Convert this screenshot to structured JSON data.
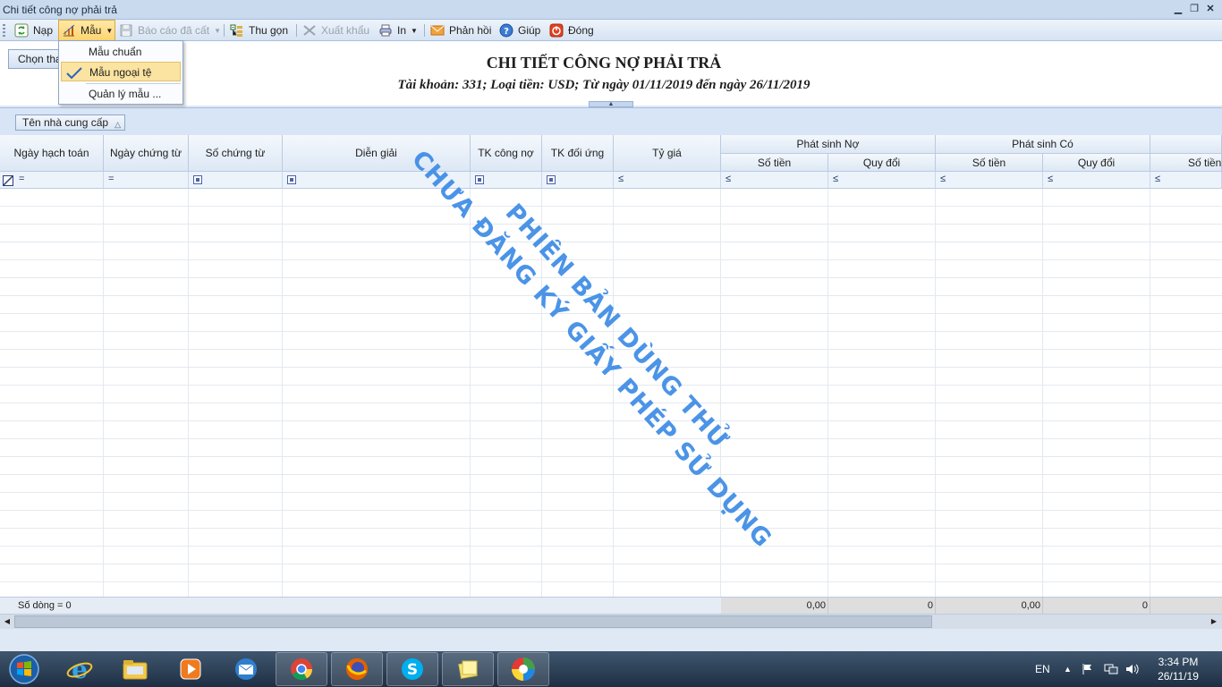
{
  "window": {
    "title": "Chi tiết công nợ phải trả"
  },
  "toolbar": {
    "nap": "Nạp",
    "mau": "Mẫu",
    "bao_cao_da_cat": "Báo cáo đã cất",
    "thu_gon": "Thu gọn",
    "xuat_khau": "Xuất khẩu",
    "in": "In",
    "phan_hoi": "Phản hồi",
    "giup": "Giúp",
    "dong": "Đóng"
  },
  "template_menu": {
    "items": [
      "Mẫu chuẩn",
      "Mẫu ngoại tệ",
      "Quản lý mẫu ..."
    ],
    "selected": "Mẫu ngoại tệ"
  },
  "options_button": "Chọn tham số...",
  "report": {
    "title": "CHI TIẾT CÔNG NỢ PHẢI TRẢ",
    "subtitle": "Tài khoản: 331; Loại tiền: USD; Từ ngày 01/11/2019 đến ngày 26/11/2019"
  },
  "group_panel": {
    "group_by": "Tên nhà cung cấp"
  },
  "grid": {
    "columns": {
      "ngay_hach_toan": "Ngày hạch toán",
      "ngay_chung_tu": "Ngày chứng từ",
      "so_chung_tu": "Số chứng từ",
      "dien_giai": "Diễn giải",
      "tk_cong_no": "TK công nợ",
      "tk_doi_ung": "TK đối ứng",
      "ty_gia": "Tỷ giá",
      "phat_sinh_no": "Phát sinh Nợ",
      "phat_sinh_co": "Phát sinh Có",
      "so_tien": "Số tiền",
      "quy_doi": "Quy đổi"
    },
    "filter_ops": {
      "equals": "=",
      "lte": "≤"
    },
    "row_count": "Số dòng = 0",
    "totals": {
      "no_so_tien": "0,00",
      "no_quy_doi": "0",
      "co_so_tien": "0,00",
      "co_quy_doi": "0"
    }
  },
  "watermark": {
    "line1": "PHIÊN BẢN DÙNG THỬ",
    "line2": "CHƯA ĐĂNG KÝ GIẤY PHÉP SỬ DỤNG"
  },
  "taskbar": {
    "language": "EN",
    "time": "3:34 PM",
    "date": "26/11/19"
  }
}
